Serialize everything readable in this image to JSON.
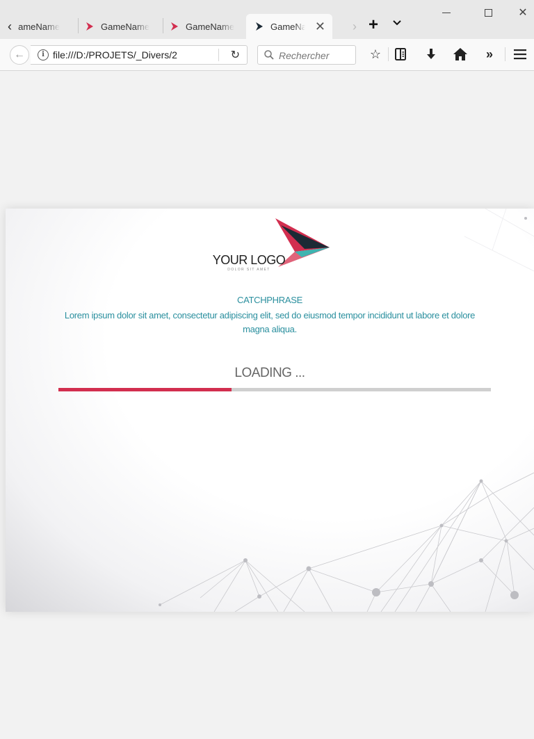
{
  "browser": {
    "tabs": [
      {
        "label": "GameName",
        "active": false
      },
      {
        "label": "GameName",
        "active": false
      },
      {
        "label": "GameName",
        "active": false
      },
      {
        "label": "GameName",
        "active": true
      }
    ],
    "url": "file:///D:/PROJETS/_Divers/2",
    "search_placeholder": "Rechercher"
  },
  "loader": {
    "logo_text": "YOUR LOGO",
    "logo_subtext": "DOLOR SIT AMET",
    "catchphrase": "CATCHPHRASE",
    "description": "Lorem ipsum dolor sit amet, consectetur adipiscing elit, sed do eiusmod tempor incididunt ut labore et dolore magna aliqua.",
    "loading_label": "LOADING ...",
    "progress": 0.4
  },
  "colors": {
    "accent": "#d22e4f",
    "teal": "#2a8f9e"
  }
}
